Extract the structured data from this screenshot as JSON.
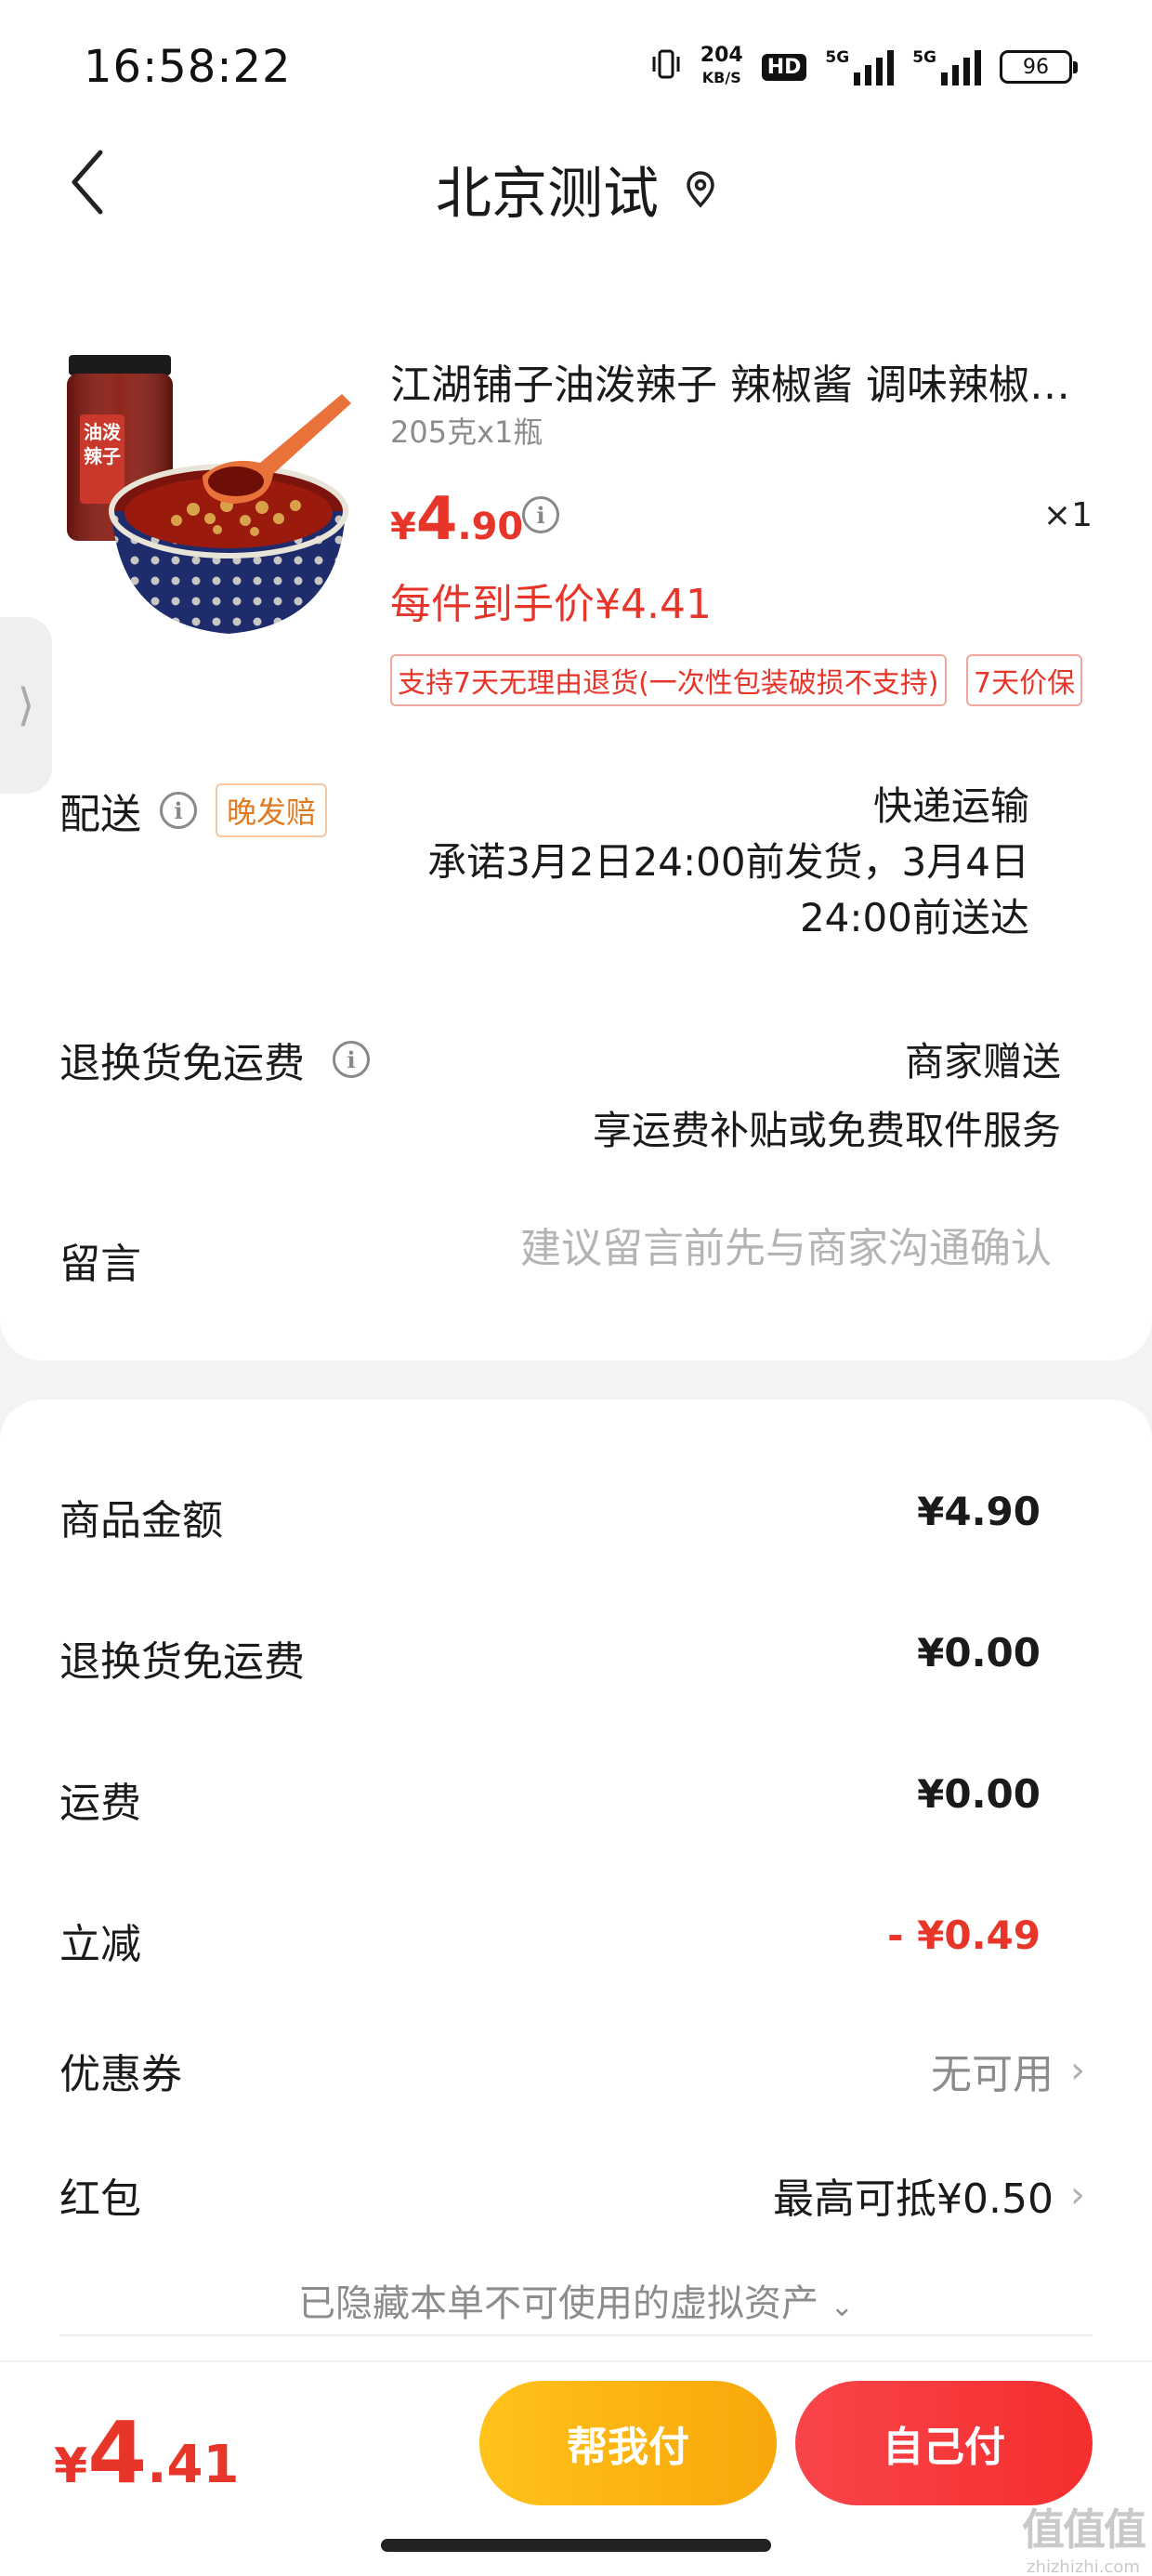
{
  "status_bar": {
    "time": "16:58:22",
    "net_speed_value": "204",
    "net_speed_unit": "KB/S",
    "hd_label": "HD",
    "sim1_label": "5G",
    "sim2_label": "5G",
    "battery": "96"
  },
  "header": {
    "title": "北京测试"
  },
  "product": {
    "name": "江湖铺子油泼辣子 辣椒酱 调味辣椒…",
    "spec": "205克x1瓶",
    "price_symbol": "¥",
    "price_int": "4",
    "price_dec": ".90",
    "quantity": "×1",
    "final_price": "每件到手价¥4.41",
    "tag_return": "支持7天无理由退货(一次性包装破损不支持)",
    "tag_price_protect": "7天价保",
    "image_jar_label": "油泼辣子"
  },
  "delivery": {
    "label": "配送",
    "late_tag": "晚发赔",
    "method": "快递运输",
    "promise_line1": "承诺3月2日24:00前发货，3月4日",
    "promise_line2": "24:00前送达"
  },
  "return_shipping": {
    "label": "退换货免运费",
    "value_line1": "商家赠送",
    "value_line2": "享运费补贴或免费取件服务"
  },
  "message": {
    "label": "留言",
    "placeholder": "建议留言前先与商家沟通确认"
  },
  "summary": {
    "goods_amount_label": "商品金额",
    "goods_amount_value": "¥4.90",
    "return_fee_label": "退换货免运费",
    "return_fee_value": "¥0.00",
    "shipping_label": "运费",
    "shipping_value": "¥0.00",
    "discount_label": "立减",
    "discount_value": "- ¥0.49",
    "coupon_label": "优惠券",
    "coupon_value": "无可用",
    "red_packet_label": "红包",
    "red_packet_value": "最高可抵¥0.50",
    "hidden_assets": "已隐藏本单不可使用的虚拟资产"
  },
  "footer": {
    "total_symbol": "¥",
    "total_int": "4",
    "total_dec": ".41",
    "help_pay_button": "帮我付",
    "self_pay_button": "自己付"
  },
  "watermark": {
    "logo": "值值值",
    "url": "zhizhizhi.com"
  },
  "colors": {
    "accent_red": "#e8352a",
    "button_yellow": "#ffc21a",
    "button_red": "#f8454a",
    "late_tag_orange": "#e07a1f"
  }
}
